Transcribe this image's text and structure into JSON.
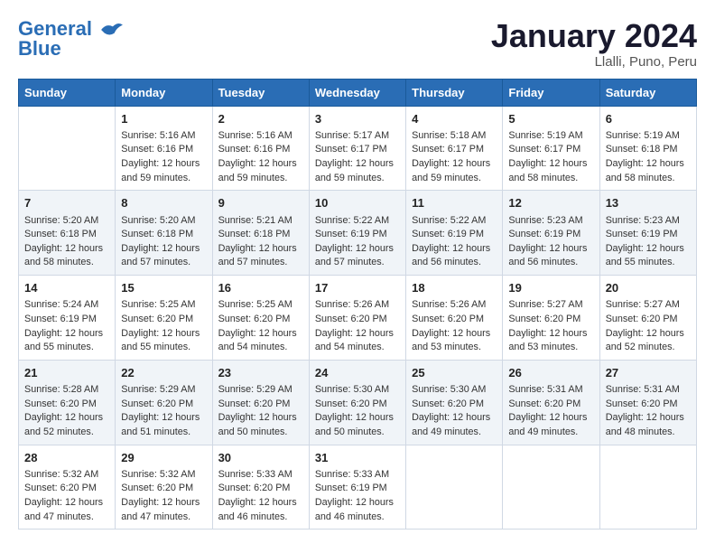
{
  "header": {
    "logo_line1": "General",
    "logo_line2": "Blue",
    "title": "January 2024",
    "subtitle": "Llalli, Puno, Peru"
  },
  "columns": [
    "Sunday",
    "Monday",
    "Tuesday",
    "Wednesday",
    "Thursday",
    "Friday",
    "Saturday"
  ],
  "weeks": [
    [
      {
        "day": "",
        "info": ""
      },
      {
        "day": "1",
        "info": "Sunrise: 5:16 AM\nSunset: 6:16 PM\nDaylight: 12 hours\nand 59 minutes."
      },
      {
        "day": "2",
        "info": "Sunrise: 5:16 AM\nSunset: 6:16 PM\nDaylight: 12 hours\nand 59 minutes."
      },
      {
        "day": "3",
        "info": "Sunrise: 5:17 AM\nSunset: 6:17 PM\nDaylight: 12 hours\nand 59 minutes."
      },
      {
        "day": "4",
        "info": "Sunrise: 5:18 AM\nSunset: 6:17 PM\nDaylight: 12 hours\nand 59 minutes."
      },
      {
        "day": "5",
        "info": "Sunrise: 5:19 AM\nSunset: 6:17 PM\nDaylight: 12 hours\nand 58 minutes."
      },
      {
        "day": "6",
        "info": "Sunrise: 5:19 AM\nSunset: 6:18 PM\nDaylight: 12 hours\nand 58 minutes."
      }
    ],
    [
      {
        "day": "7",
        "info": "Sunrise: 5:20 AM\nSunset: 6:18 PM\nDaylight: 12 hours\nand 58 minutes."
      },
      {
        "day": "8",
        "info": "Sunrise: 5:20 AM\nSunset: 6:18 PM\nDaylight: 12 hours\nand 57 minutes."
      },
      {
        "day": "9",
        "info": "Sunrise: 5:21 AM\nSunset: 6:18 PM\nDaylight: 12 hours\nand 57 minutes."
      },
      {
        "day": "10",
        "info": "Sunrise: 5:22 AM\nSunset: 6:19 PM\nDaylight: 12 hours\nand 57 minutes."
      },
      {
        "day": "11",
        "info": "Sunrise: 5:22 AM\nSunset: 6:19 PM\nDaylight: 12 hours\nand 56 minutes."
      },
      {
        "day": "12",
        "info": "Sunrise: 5:23 AM\nSunset: 6:19 PM\nDaylight: 12 hours\nand 56 minutes."
      },
      {
        "day": "13",
        "info": "Sunrise: 5:23 AM\nSunset: 6:19 PM\nDaylight: 12 hours\nand 55 minutes."
      }
    ],
    [
      {
        "day": "14",
        "info": "Sunrise: 5:24 AM\nSunset: 6:19 PM\nDaylight: 12 hours\nand 55 minutes."
      },
      {
        "day": "15",
        "info": "Sunrise: 5:25 AM\nSunset: 6:20 PM\nDaylight: 12 hours\nand 55 minutes."
      },
      {
        "day": "16",
        "info": "Sunrise: 5:25 AM\nSunset: 6:20 PM\nDaylight: 12 hours\nand 54 minutes."
      },
      {
        "day": "17",
        "info": "Sunrise: 5:26 AM\nSunset: 6:20 PM\nDaylight: 12 hours\nand 54 minutes."
      },
      {
        "day": "18",
        "info": "Sunrise: 5:26 AM\nSunset: 6:20 PM\nDaylight: 12 hours\nand 53 minutes."
      },
      {
        "day": "19",
        "info": "Sunrise: 5:27 AM\nSunset: 6:20 PM\nDaylight: 12 hours\nand 53 minutes."
      },
      {
        "day": "20",
        "info": "Sunrise: 5:27 AM\nSunset: 6:20 PM\nDaylight: 12 hours\nand 52 minutes."
      }
    ],
    [
      {
        "day": "21",
        "info": "Sunrise: 5:28 AM\nSunset: 6:20 PM\nDaylight: 12 hours\nand 52 minutes."
      },
      {
        "day": "22",
        "info": "Sunrise: 5:29 AM\nSunset: 6:20 PM\nDaylight: 12 hours\nand 51 minutes."
      },
      {
        "day": "23",
        "info": "Sunrise: 5:29 AM\nSunset: 6:20 PM\nDaylight: 12 hours\nand 50 minutes."
      },
      {
        "day": "24",
        "info": "Sunrise: 5:30 AM\nSunset: 6:20 PM\nDaylight: 12 hours\nand 50 minutes."
      },
      {
        "day": "25",
        "info": "Sunrise: 5:30 AM\nSunset: 6:20 PM\nDaylight: 12 hours\nand 49 minutes."
      },
      {
        "day": "26",
        "info": "Sunrise: 5:31 AM\nSunset: 6:20 PM\nDaylight: 12 hours\nand 49 minutes."
      },
      {
        "day": "27",
        "info": "Sunrise: 5:31 AM\nSunset: 6:20 PM\nDaylight: 12 hours\nand 48 minutes."
      }
    ],
    [
      {
        "day": "28",
        "info": "Sunrise: 5:32 AM\nSunset: 6:20 PM\nDaylight: 12 hours\nand 47 minutes."
      },
      {
        "day": "29",
        "info": "Sunrise: 5:32 AM\nSunset: 6:20 PM\nDaylight: 12 hours\nand 47 minutes."
      },
      {
        "day": "30",
        "info": "Sunrise: 5:33 AM\nSunset: 6:20 PM\nDaylight: 12 hours\nand 46 minutes."
      },
      {
        "day": "31",
        "info": "Sunrise: 5:33 AM\nSunset: 6:19 PM\nDaylight: 12 hours\nand 46 minutes."
      },
      {
        "day": "",
        "info": ""
      },
      {
        "day": "",
        "info": ""
      },
      {
        "day": "",
        "info": ""
      }
    ]
  ]
}
